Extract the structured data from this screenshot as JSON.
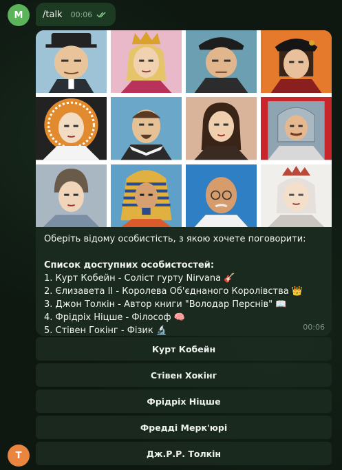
{
  "user_avatar_letter": "M",
  "bot_avatar_letter": "T",
  "command": {
    "text": "/talk",
    "time": "00:06"
  },
  "message": {
    "intro": "Оберіть відому особистість, з якою хочете поговорити:",
    "list_heading": "Список доступних особистостей:",
    "items": [
      {
        "text": "1. Курт Кобейн - Соліст гурту Nirvana",
        "emoji": "🎸"
      },
      {
        "text": "2. Єлизавета II - Королева Об'єднаного Королівства",
        "emoji": "👑"
      },
      {
        "text": "3. Джон Толкін - Автор книги \"Володар Перснів\"",
        "emoji": "📖"
      },
      {
        "text": "4. Фрідріх Ніцше - Філософ",
        "emoji": "🧠"
      },
      {
        "text": "5. Стівен Гокінг - Фізик",
        "emoji": "🔬"
      }
    ],
    "time": "00:06"
  },
  "keyboard": [
    {
      "label": "Курт Кобейн"
    },
    {
      "label": "Стівен Хокінг"
    },
    {
      "label": "Фрідріх Ніцше"
    },
    {
      "label": "Фредді Мерк'юрі"
    },
    {
      "label": "Дж.Р.Р. Толкін"
    }
  ],
  "colors": {
    "accent": "#5bb35a",
    "bot_avatar": "#e9853f",
    "bubble_out": "#1d3a23",
    "card": "#1a2a1e"
  }
}
